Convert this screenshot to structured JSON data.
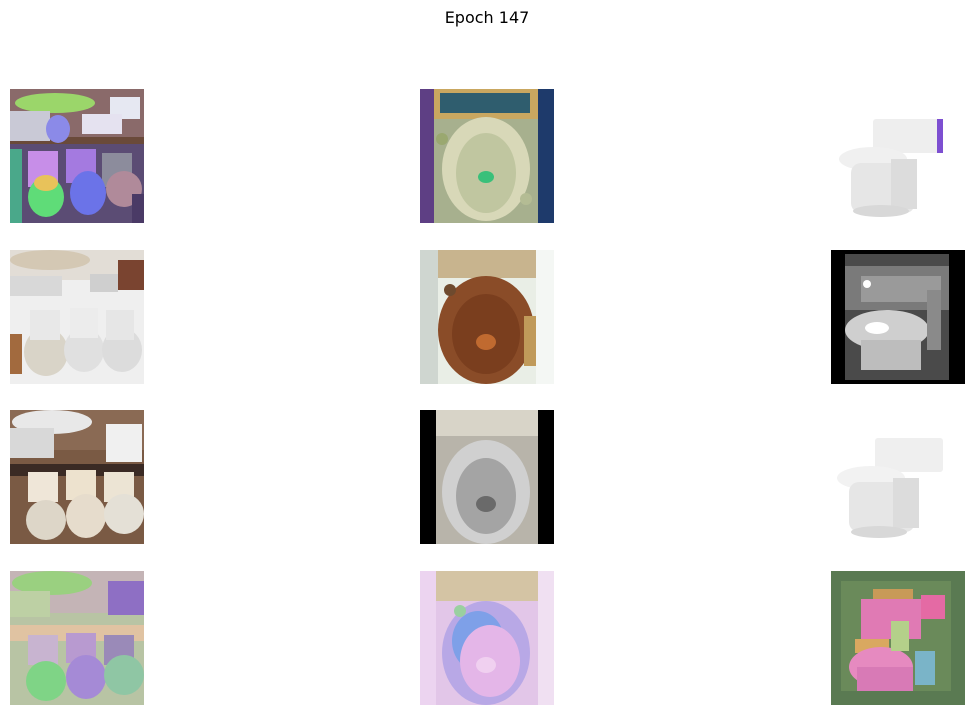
{
  "figure": {
    "title": "Epoch 147"
  }
}
